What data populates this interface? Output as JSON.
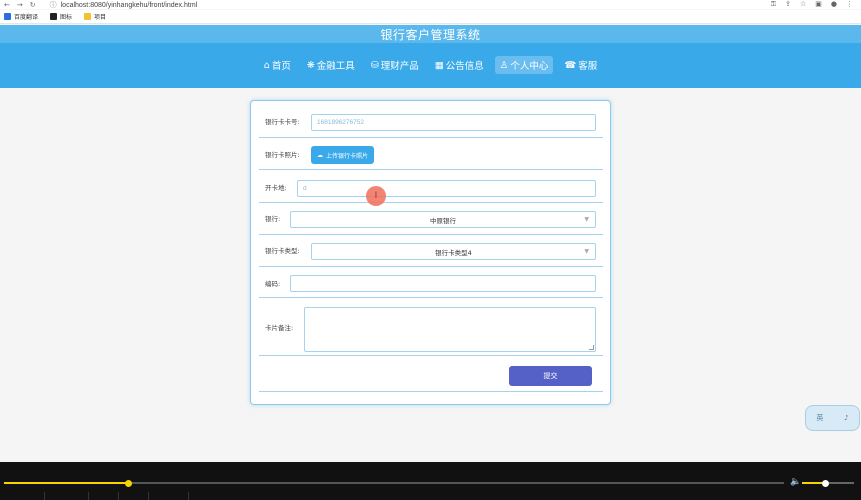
{
  "browser": {
    "url": "localhost:8080/yinhangkehu/front/index.html",
    "bookmarks": [
      {
        "label": "百度翻译",
        "color": "#2b6de0"
      },
      {
        "label": "图标",
        "color": "#222222"
      },
      {
        "label": "项目",
        "color": "#f2c230"
      }
    ]
  },
  "site": {
    "title": "银行客户管理系统",
    "nav": [
      {
        "icon": "⌂",
        "label": "首页",
        "active": false
      },
      {
        "icon": "❋",
        "label": "金融工具",
        "active": false
      },
      {
        "icon": "⛁",
        "label": "理财产品",
        "active": false
      },
      {
        "icon": "▦",
        "label": "公告信息",
        "active": false
      },
      {
        "icon": "♙",
        "label": "个人中心",
        "active": true
      },
      {
        "icon": "☎",
        "label": "客服",
        "active": false
      }
    ]
  },
  "form": {
    "card_number_label": "银行卡卡号:",
    "card_number_value": "1681896276752",
    "card_photo_label": "银行卡照片:",
    "upload_label": "上传银行卡照片",
    "open_place_label": "开卡地:",
    "open_place_value": "d",
    "bank_label": "银行:",
    "bank_value": "中原银行",
    "card_type_label": "银行卡类型:",
    "card_type_value": "银行卡类型4",
    "code_label": "编码:",
    "code_value": "",
    "remark_label": "卡片备注:",
    "submit_label": "提交"
  },
  "widget": {
    "left": "英",
    "right": "♪"
  },
  "player": {
    "progress": 0.16,
    "volume": 0.45
  },
  "colors": {
    "accent": "#39a9ea",
    "submit": "#5561c6",
    "highlight": "#f5d400"
  }
}
